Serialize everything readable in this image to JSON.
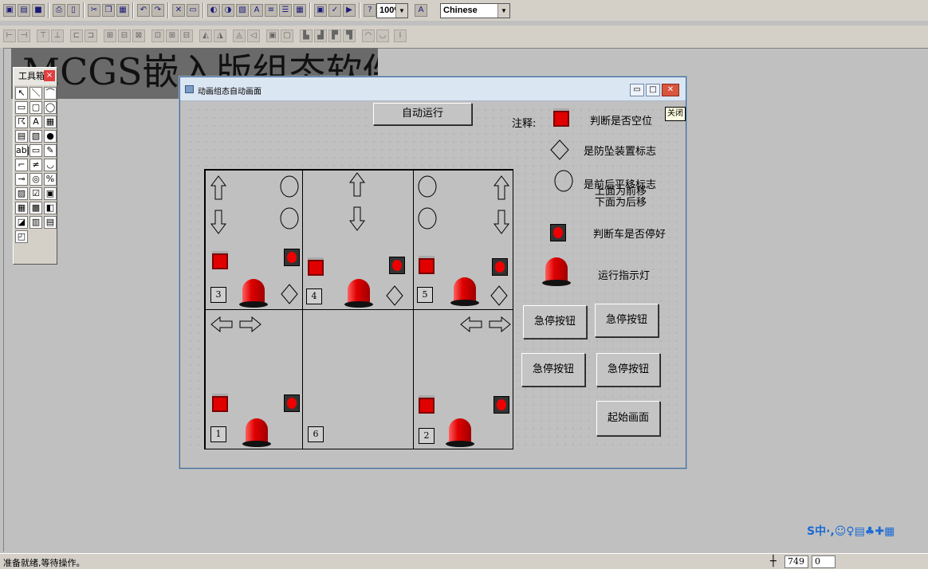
{
  "toolbar": {
    "zoom_value": "100%",
    "language_value": "Chinese"
  },
  "workspace": {
    "banner_title": "MCGS嵌入版组态软件"
  },
  "toolbox": {
    "title": "工具箱",
    "close_glyph": "×",
    "tools": [
      "↖",
      "＼",
      "⌒",
      "▭",
      "▢",
      "◯",
      "☈",
      "A",
      "▦",
      "▤",
      "▧",
      "●",
      "ab|",
      "▭",
      "✎",
      "⌐",
      "≠",
      "◡",
      "⊸",
      "◎",
      "%",
      "▨",
      "☑",
      "▣",
      "▦",
      "▩",
      "◧",
      "◪",
      "▥",
      "▤",
      "◰"
    ]
  },
  "window": {
    "title": "动画组态自动画面",
    "min_glyph": "▭",
    "max_glyph": "□",
    "close_glyph": "✕",
    "auto_run_button": "自动运行",
    "legend_title": "注释:",
    "legend": [
      {
        "icon": "red-square",
        "text": "判断是否空位"
      },
      {
        "icon": "diamond",
        "text": "是防坠装置标志"
      },
      {
        "icon": "circle",
        "text": "是前后平移标志"
      },
      {
        "icon": "note",
        "text": "上面为前移"
      },
      {
        "icon": "note",
        "text": "下面为后移"
      },
      {
        "icon": "bulb",
        "text": "判断车是否停好"
      },
      {
        "icon": "lamp",
        "text": "运行指示灯"
      }
    ],
    "estop_buttons": [
      "急停按钮",
      "急停按钮",
      "急停按钮",
      "急停按钮"
    ],
    "start_screen_button": "起始画面",
    "cells": [
      {
        "num": "3"
      },
      {
        "num": "4"
      },
      {
        "num": "5"
      },
      {
        "num": "1"
      },
      {
        "num": "6"
      },
      {
        "num": "2"
      }
    ]
  },
  "tooltip": {
    "close": "关闭"
  },
  "statusbar": {
    "message": "准备就绪,等待操作。",
    "cursor_glyph": "┼",
    "coord_x": "749",
    "coord_y": "0"
  },
  "ime": {
    "bar_text": "S中·,☺♀▤♣✚▦"
  },
  "colors": {
    "indicator_red": "#e00000",
    "title_blue": "#dbe6f3",
    "canvas_gray": "#c0c0c0"
  }
}
